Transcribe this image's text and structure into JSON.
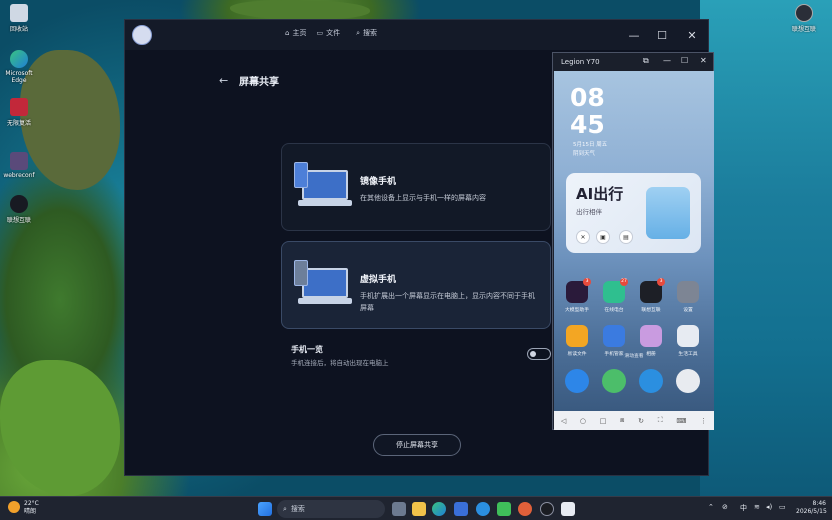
{
  "desktop": {
    "icons": [
      {
        "label": "回收站"
      },
      {
        "label": "Microsoft Edge"
      },
      {
        "label": "无限复活"
      },
      {
        "label": "webreconf"
      },
      {
        "label": "联想互联"
      }
    ],
    "top_right_icon": {
      "label": "联想互联"
    }
  },
  "window": {
    "nav": {
      "home": "主页",
      "files": "文件",
      "search": "搜索"
    },
    "controls": {
      "minimize": "—",
      "maximize": "☐",
      "close": "✕"
    },
    "page_title": "屏幕共享",
    "cards": [
      {
        "title": "镜像手机",
        "desc": "在其他设备上显示与手机一样的屏幕内容"
      },
      {
        "title": "虚拟手机",
        "desc": "手机扩展出一个屏幕显示在电脑上，显示内容不同于手机屏幕"
      }
    ],
    "phone_list": {
      "title": "手机一览",
      "desc": "手机连接后，将自动出现在电脑上",
      "enabled": false
    },
    "stop_button": "停止屏幕共享"
  },
  "phone_window": {
    "title": "Legion Y70",
    "time_hour": "08",
    "time_minute": "45",
    "date": "5月15日 周五",
    "weather": "阴到天气",
    "ai_card": {
      "title": "AI出行",
      "subtitle": "出行相伴"
    },
    "apps": [
      {
        "label": "大模型助手",
        "badge": "3",
        "color": "#2a1a3a"
      },
      {
        "label": "在线电台",
        "badge": "27",
        "color": "#2fbf8f"
      },
      {
        "label": "联想互联",
        "badge": "3",
        "color": "#1d1f26"
      },
      {
        "label": "设置",
        "badge": "",
        "color": "#7d8594"
      },
      {
        "label": "易读文件",
        "badge": "",
        "color": "#f3a623"
      },
      {
        "label": "手机管家",
        "badge": "",
        "color": "#3b7be0"
      },
      {
        "label": "相册",
        "badge": "",
        "color": "#c99be0"
      },
      {
        "label": "生活工具",
        "badge": "",
        "color": "#e7ebf2"
      }
    ],
    "page_hint": "滑动查看",
    "dock": [
      {
        "name": "phone",
        "color": "#2d86e8"
      },
      {
        "name": "messages",
        "color": "#4cbe6a"
      },
      {
        "name": "browser",
        "color": "#2b8fe0"
      },
      {
        "name": "camera",
        "color": "#e8ebf0"
      }
    ]
  },
  "taskbar": {
    "weather_temp": "22°C",
    "weather_text": "晴朗",
    "search_label": "搜索",
    "tray_ime": "中",
    "time": "8:46",
    "date": "2026/5/15"
  }
}
